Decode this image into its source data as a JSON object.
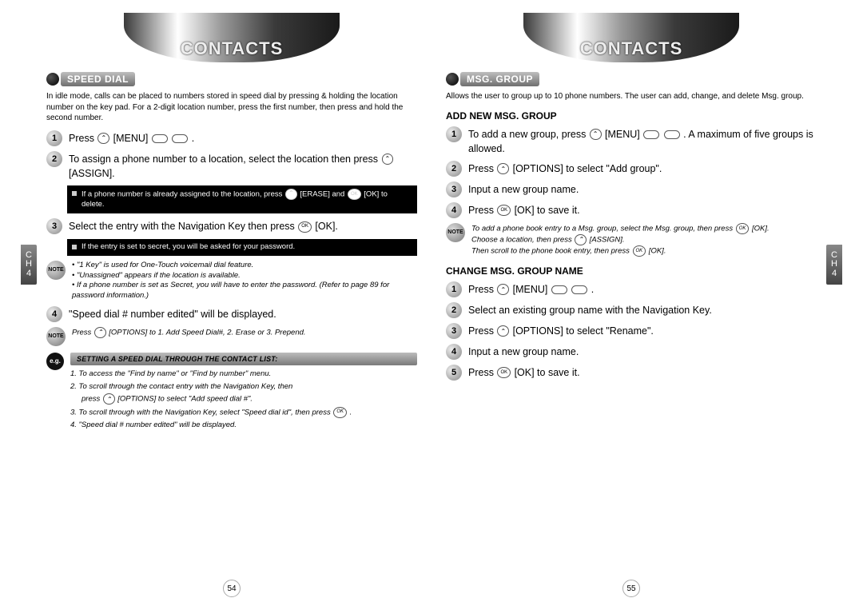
{
  "left": {
    "header": "CONTACTS",
    "section": "SPEED DIAL",
    "intro": "In idle mode, calls can be placed to numbers stored in speed dial by pressing & holding the location number on the key pad. For a 2-digit location number, press the first number, then press and hold the second number.",
    "step1": "Press ",
    "step1b": " [MENU] ",
    "step1c": " .",
    "step2": "To assign a phone number to a location, select the location then press ",
    "step2b": " [ASSIGN].",
    "black1": "If a phone number is already assigned to the location, press ",
    "black1b": " [ERASE] and ",
    "black1c": " [OK] to delete.",
    "step3": "Select the entry with the Navigation Key then press ",
    "step3b": " [OK].",
    "black2": "If the entry is set to secret, you will be asked for your password.",
    "note_items": [
      "\"1 Key\" is used for One-Touch voicemail dial feature.",
      "\"Unassigned\" appears if the location is available.",
      "If a phone number is set as Secret, you will have to enter the password. (Refer to page 89 for password information.)"
    ],
    "step4": "\"Speed dial # number edited\" will be displayed.",
    "note2": "Press ",
    "note2b": " [OPTIONS] to 1. Add Speed Dial#, 2. Erase or 3. Prepend.",
    "eg_title": "SETTING A SPEED DIAL THROUGH THE CONTACT LIST:",
    "eg_items": {
      "i1": "1. To access the \"Find by name\" or \"Find by number\" menu.",
      "i2": "2. To scroll through the contact entry with the Navigation Key, then",
      "i2sub": "press      [OPTIONS] to select \"Add speed dial #\".",
      "i3": "3. To scroll through with the Navigation Key, select \"Speed dial id\", then press      .",
      "i4": "4. \"Speed dial # number edited\" will be displayed."
    },
    "pagenum": "54",
    "sidetab": [
      "C",
      "H",
      "4"
    ]
  },
  "right": {
    "header": "CONTACTS",
    "section": "MSG. GROUP",
    "intro": "Allows the user to group up to 10 phone numbers. The user can add, change, and delete Msg. group.",
    "sub1": "ADD NEW MSG. GROUP",
    "s1_step1a": "To add a new group, press ",
    "s1_step1b": " [MENU] ",
    "s1_step1c": " . A maximum of five groups is allowed.",
    "s1_step2a": "Press ",
    "s1_step2b": " [OPTIONS] to select \"Add group\".",
    "s1_step3": "Input a new group name.",
    "s1_step4a": "Press ",
    "s1_step4b": " [OK] to save it.",
    "note_lines": [
      "To add a phone book entry to a Msg. group, select the Msg. group, then press      [OK].",
      "Choose a location, then press      [ASSIGN].",
      "Then scroll to the phone book entry, then press      [OK]."
    ],
    "sub2": "CHANGE MSG. GROUP NAME",
    "s2_step1a": "Press ",
    "s2_step1b": " [MENU] ",
    "s2_step1c": " .",
    "s2_step2": "Select an existing group name with the Navigation Key.",
    "s2_step3a": "Press ",
    "s2_step3b": " [OPTIONS] to select \"Rename\".",
    "s2_step4": "Input a new group name.",
    "s2_step5a": "Press ",
    "s2_step5b": " [OK] to save it.",
    "pagenum": "55",
    "sidetab": [
      "C",
      "H",
      "4"
    ]
  }
}
